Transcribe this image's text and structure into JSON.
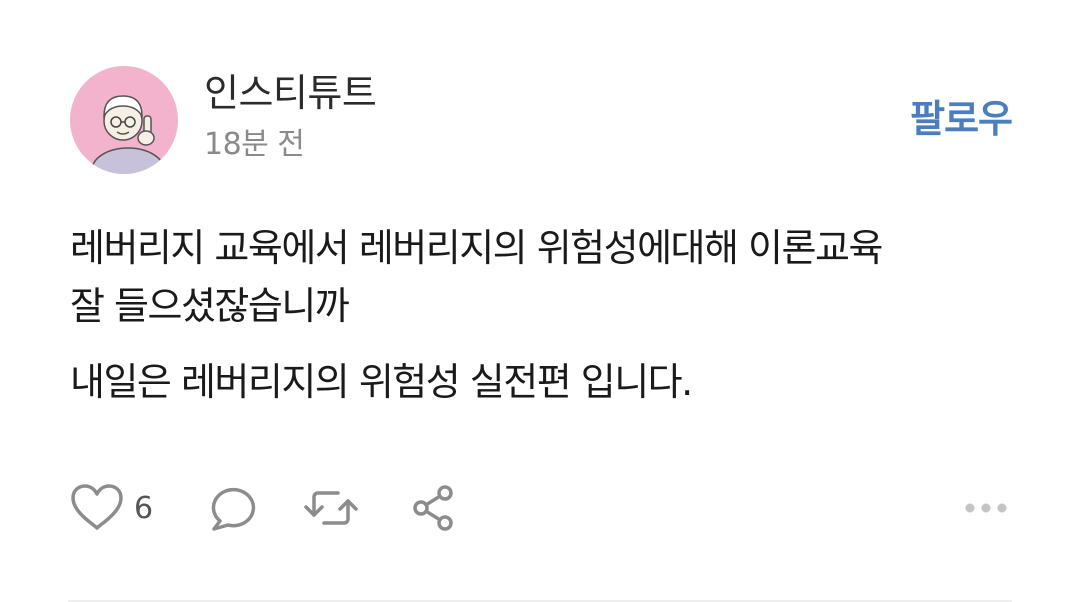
{
  "post": {
    "author": "인스티튜트",
    "time": "18분 전",
    "follow_label": "팔로우",
    "lines": [
      "레버리지 교육에서 레버리지의 위험성에대해 이론교육",
      "잘 들으셨잖습니까"
    ],
    "second_paragraph": "내일은 레버리지의 위험성 실전편 입니다.",
    "like_count": "6"
  },
  "icons": {
    "like": "heart-icon",
    "comment": "comment-icon",
    "repost": "repost-icon",
    "share": "share-icon",
    "more": "more-icon"
  },
  "colors": {
    "accent": "#4a7ec0",
    "avatar_bg": "#f3b3cc",
    "icon": "#8c8c8c",
    "muted_text": "#8a8a8a"
  }
}
